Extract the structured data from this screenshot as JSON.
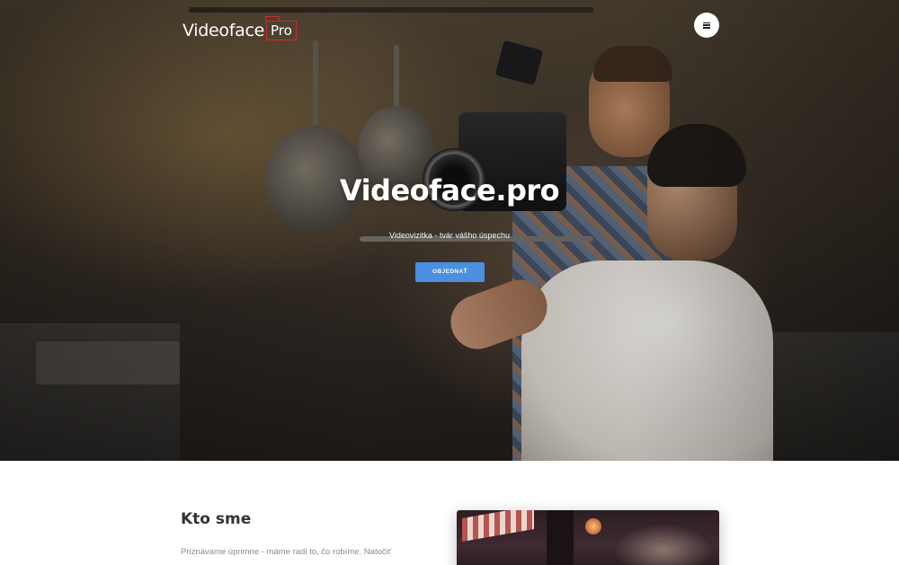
{
  "header": {
    "logo_word": "Videoface",
    "logo_badge": "Pro"
  },
  "hero": {
    "title": "Videoface.pro",
    "subtitle": "Videovizitka - tvár vášho úspechu",
    "cta_label": "OBJEDNAŤ"
  },
  "about": {
    "title": "Kto sme",
    "text": "Priznávame úprimne - máme radi to, čo robíme. Natočiť"
  },
  "icons": {
    "menu": "hamburger-icon"
  },
  "colors": {
    "accent": "#4a8fe0",
    "logo_frame": "#d12b2b"
  }
}
